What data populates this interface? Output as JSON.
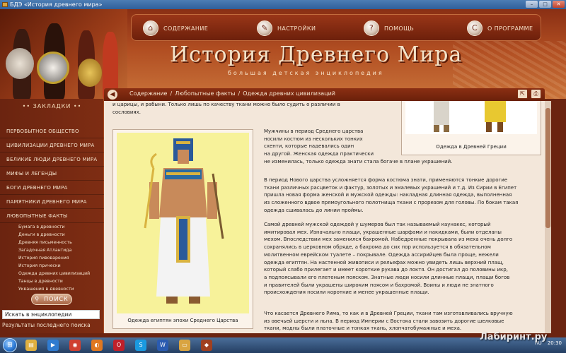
{
  "window": {
    "title": "БДЭ «История древнего мира»",
    "buttons": {
      "minimize": "–",
      "maximize": "□",
      "close": "✕"
    }
  },
  "nav": {
    "items": [
      {
        "label": "СОДЕРЖАНИЕ",
        "icon": "home-icon",
        "glyph": "⌂"
      },
      {
        "label": "НАСТРОЙКИ",
        "icon": "wrench-icon",
        "glyph": "✎"
      },
      {
        "label": "ПОМОЩЬ",
        "icon": "help-icon",
        "glyph": "?"
      },
      {
        "label": "О ПРОГРАММЕ",
        "icon": "info-icon",
        "glyph": "C"
      }
    ]
  },
  "site": {
    "title": "История Древнего Мира",
    "subtitle": "большая детская энциклопедия"
  },
  "breadcrumb": {
    "back": "◀",
    "items": [
      "Содержание",
      "Любопытные факты",
      "Одежда древних цивилизаций"
    ],
    "sep": "/",
    "tools": [
      "⇱",
      "⎙"
    ]
  },
  "sidebar": {
    "bookmarks_label": "•• ЗАКЛАДКИ ••",
    "menu": [
      "ПЕРВОБЫТНОЕ ОБЩЕСТВО",
      "ЦИВИЛИЗАЦИИ ДРЕВНЕГО МИРА",
      "ВЕЛИКИЕ ЛЮДИ ДРЕВНЕГО МИРА",
      "МИФЫ И ЛЕГЕНДЫ",
      "БОГИ ДРЕВНЕГО МИРА",
      "ПАМЯТНИКИ ДРЕВНЕГО МИРА",
      "ЛЮБОПЫТНЫЕ ФАКТЫ"
    ],
    "submenu": [
      "Бумага в древности",
      "Деньги в древности",
      "Древняя письменность",
      "Загадочная Атлантида",
      "История пивоварения",
      "История прически",
      "Одежда древних цивилизаций",
      "Танцы в древности",
      "Украшения в древности"
    ],
    "search_label": "ПОИСК",
    "search_in_encyclopedia": "Искать в энциклопедии",
    "last_results": "Результаты последнего поиска"
  },
  "article": {
    "top_text": "и царицы, и рабыни. Только лишь по качеству ткани можно было судить о различии в сословиях.",
    "p1": [
      "Мужчины в период Среднего царства",
      "носили костюм из нескольких тонких",
      "схенти, которые надевались один",
      "на другой. Женская одежда практически",
      "не изменилась, только одежда знати стала богаче в плане украшений."
    ],
    "p2": [
      "В период Нового царства усложняется форма костюма знати, применяются тонкие дорогие",
      "ткани различных расцветок и фактур, золотых и эмалевых украшений и т.д. Из Сирии в Египет",
      "пришла новая форма женской и мужской одежды: накладная длинная одежда, выполненная",
      "из сложенного вдвое прямоугольного полотнища ткани с прорезом для головы. По бокам такая",
      "одежда сшивалась до линии проймы."
    ],
    "p3": [
      "Самой древней мужской одеждой у шумеров был так называемый каунакес, который",
      "имитировал мех. Изначально плащи, украшенные шарфами и накидками, были отделаны",
      "мехом. Впоследствии мех заменился бахромой. Набедренные покрывала из меха очень долго",
      "сохранялись в церковном обряде, а бахрома до сих пор используется в обязательном",
      "молитвенном еврейском туалете – покрывале. Одежда ассирийцев была проще, нежели",
      "одежда египтян. На настенной живописи и рельефах можно увидеть лишь верхний плащ,",
      "который слабо прилегает и имеет короткие рукава до локтя. Он достигал до половины икр,",
      "а подпоясывали его плетеным пояском. Знатные люди носили длинные плащи, плащи богов",
      "и правителей были украшены широким поясом и бахромой. Воины и люди не знатного",
      "происхождения носили короткие и менее украшенные плащи."
    ],
    "p4": [
      "Что касается Древнего Рима, то как и в Древней Греции, ткани там изготавливались вручную",
      "из овечьей шерсти и льна. В период Империи с Востока стали завозить дорогие шелковые",
      "ткани, модны были платочные и тонкая ткань, хлопчатобумажные и меха."
    ],
    "fig1_caption": "Одежда египтян эпохи Среднего Царства",
    "fig2_caption": "Одежда в Древней Греции"
  },
  "taskbar": {
    "start": "⊞",
    "lang": "RU",
    "time": "20:30",
    "icons": [
      {
        "name": "explorer-icon",
        "glyph": "▤",
        "color": "#e0b040"
      },
      {
        "name": "media-player-icon",
        "glyph": "▶",
        "color": "#2f7bd0"
      },
      {
        "name": "chrome-icon",
        "glyph": "◉",
        "color": "#d04030"
      },
      {
        "name": "firefox-icon",
        "glyph": "◐",
        "color": "#e07820"
      },
      {
        "name": "opera-icon",
        "glyph": "O",
        "color": "#c0202a"
      },
      {
        "name": "skype-icon",
        "glyph": "S",
        "color": "#1a9ae0"
      },
      {
        "name": "word-icon",
        "glyph": "W",
        "color": "#2a5bb0"
      },
      {
        "name": "folder-icon",
        "glyph": "▭",
        "color": "#d9a441"
      },
      {
        "name": "app-icon",
        "glyph": "◆",
        "color": "#a04020"
      }
    ]
  },
  "watermark": "Лабиринт.ру"
}
